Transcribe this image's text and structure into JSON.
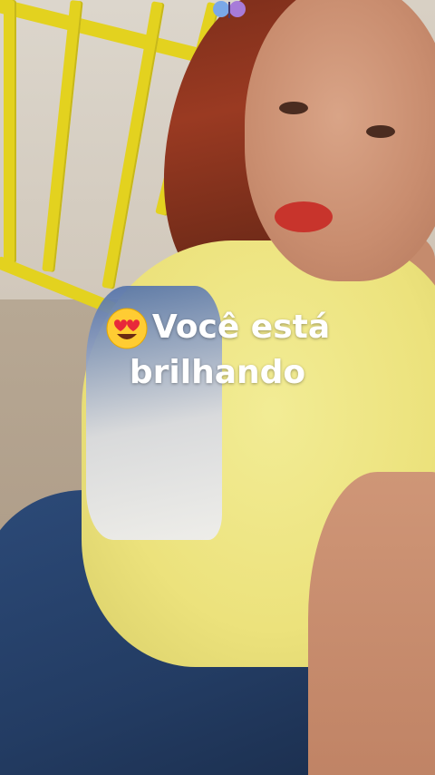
{
  "caption": {
    "line1": "Você está",
    "line2": "brilhando",
    "emoji_icon": "smiling-face-with-heart-eyes"
  },
  "sticker": {
    "icon": "butterfly-icon"
  },
  "colors": {
    "caption_text": "#ffffff",
    "railing": "#e3d21f",
    "shirt": "#ece27c",
    "jeans": "#2c4a78"
  }
}
